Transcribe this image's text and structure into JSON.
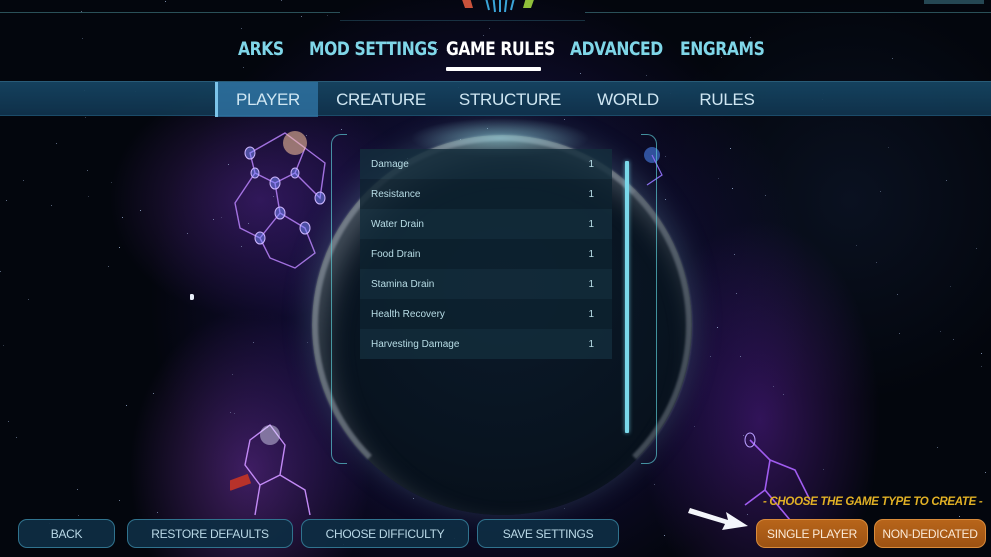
{
  "main_tabs": [
    {
      "label": "ARKS",
      "active": false
    },
    {
      "label": "MOD SETTINGS",
      "active": false
    },
    {
      "label": "GAME RULES",
      "active": true
    },
    {
      "label": "ADVANCED",
      "active": false
    },
    {
      "label": "ENGRAMS",
      "active": false
    }
  ],
  "sub_tabs": [
    {
      "label": "PLAYER",
      "active": true
    },
    {
      "label": "CREATURE",
      "active": false
    },
    {
      "label": "STRUCTURE",
      "active": false
    },
    {
      "label": "WORLD",
      "active": false
    },
    {
      "label": "RULES",
      "active": false
    }
  ],
  "settings": [
    {
      "label": "Damage",
      "value": "1"
    },
    {
      "label": "Resistance",
      "value": "1"
    },
    {
      "label": "Water Drain",
      "value": "1"
    },
    {
      "label": "Food Drain",
      "value": "1"
    },
    {
      "label": "Stamina Drain",
      "value": "1"
    },
    {
      "label": "Health Recovery",
      "value": "1"
    },
    {
      "label": "Harvesting Damage",
      "value": "1"
    }
  ],
  "bottom_buttons": {
    "back": "BACK",
    "restore_defaults": "RESTORE DEFAULTS",
    "choose_difficulty": "CHOOSE DIFFICULTY",
    "save_settings": "SAVE SETTINGS"
  },
  "game_type": {
    "prompt": "- CHOOSE THE GAME TYPE TO CREATE -",
    "single_player": "SINGLE PLAYER",
    "non_dedicated": "NON-DEDICATED"
  },
  "colors": {
    "accent_cyan": "#7fd6e8",
    "active_white": "#ffffff",
    "orange_button": "#b8651a",
    "prompt_gold": "#e2b125"
  }
}
